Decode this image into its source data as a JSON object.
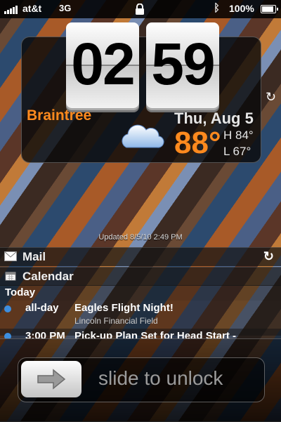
{
  "status_bar": {
    "carrier": "at&t",
    "network": "3G",
    "battery_percent": "100%",
    "battery_level": 1.0,
    "icons": [
      "signal-icon",
      "lock-icon",
      "bluetooth-icon",
      "battery-icon"
    ]
  },
  "clock": {
    "hours": "02",
    "minutes": "59"
  },
  "weather": {
    "city": "Braintree",
    "date": "Thu, Aug 5",
    "temperature": "88°",
    "high": "H 84°",
    "low": "L 67°",
    "condition_icon": "cloud-icon",
    "updated": "Updated 8/5/10 2:49 PM"
  },
  "notifications": {
    "mail_label": "Mail",
    "calendar_label": "Calendar",
    "section": "Today",
    "events": [
      {
        "time": "all-day",
        "title": "Eagles Flight Night!",
        "location": "Lincoln Financial Field"
      },
      {
        "time": "3:00 PM",
        "title": "Pick-up Plan Set for Head Start -"
      }
    ]
  },
  "unlock": {
    "text": "slide to unlock"
  },
  "colors": {
    "accent_orange": "#ff8a1e",
    "event_dot": "#3d8fe0"
  }
}
